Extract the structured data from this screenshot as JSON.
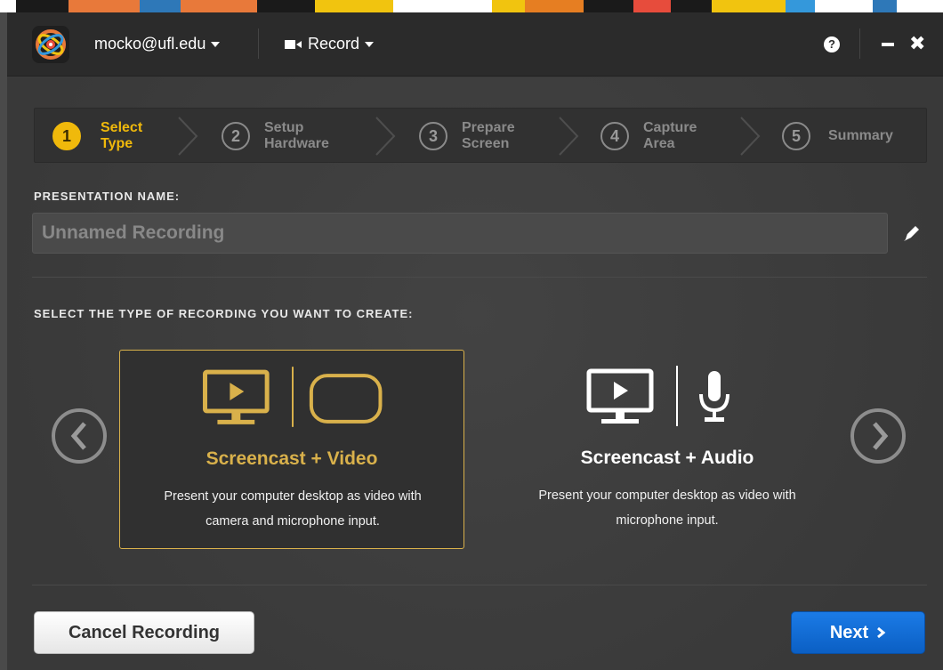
{
  "strip_colors": [
    "#1a1a1a",
    "#f39c12",
    "#2980b9",
    "#e74c3c",
    "#f1c40f",
    "#ffffff",
    "#e67e22",
    "#1a1a1a",
    "#f1c40f",
    "#3498db",
    "#e74c3c",
    "#1a1a1a",
    "#f1c40f",
    "#e67e22",
    "#2c3e50",
    "#ffffff"
  ],
  "header": {
    "account": "mocko@ufl.edu",
    "record_menu": "Record",
    "help_symbol": "?",
    "close_symbol": "✖"
  },
  "steps": [
    {
      "num": "1",
      "label_line1": "Select",
      "label_line2": "Type",
      "active": true
    },
    {
      "num": "2",
      "label_line1": "Setup",
      "label_line2": "Hardware",
      "active": false
    },
    {
      "num": "3",
      "label_line1": "Prepare",
      "label_line2": "Screen",
      "active": false
    },
    {
      "num": "4",
      "label_line1": "Capture",
      "label_line2": "Area",
      "active": false
    },
    {
      "num": "5",
      "label_line1": "Summary",
      "label_line2": "",
      "active": false
    }
  ],
  "presentation": {
    "label": "PRESENTATION NAME:",
    "placeholder": "Unnamed Recording",
    "value": ""
  },
  "recording_types": {
    "label": "SELECT THE TYPE OF RECORDING YOU WANT TO CREATE:",
    "options": [
      {
        "title": "Screencast + Video",
        "desc_line1": "Present your computer desktop as video with",
        "desc_line2": "camera and microphone input.",
        "selected": true
      },
      {
        "title": "Screencast + Audio",
        "desc_line1": "Present your computer desktop as video with",
        "desc_line2": "microphone input.",
        "selected": false
      }
    ]
  },
  "footer": {
    "cancel_label": "Cancel Recording",
    "next_label": "Next"
  },
  "colors": {
    "accent_yellow": "#f0b90b",
    "selected_gold": "#d9b14b",
    "primary_blue": "#1b7be6"
  }
}
